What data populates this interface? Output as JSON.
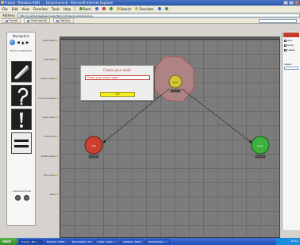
{
  "window": {
    "title": "Fronsk - Rotobna 0691 ... 1fcommerenti - Microsoft Internet Explorer",
    "buttons": [
      "_",
      "□",
      "x"
    ]
  },
  "menubar": {
    "items": [
      "File",
      "Edit",
      "View",
      "Favorites",
      "Tools",
      "Help"
    ],
    "toolbar": [
      "Back",
      "Search",
      "Favorites"
    ]
  },
  "address": {
    "label": "Address",
    "value": "http://localhost/webapp/router/fsm/commercial.php?lang=en"
  },
  "tabs": [
    {
      "label": "Fronsk"
    },
    {
      "label": "Commercial"
    },
    {
      "label": "Options"
    }
  ],
  "left_panel": {
    "title": "Navigation",
    "sub_label": "Protocol FSM Tools",
    "advanced_label": "Advanced tools"
  },
  "edge_labels": [
    "Start state",
    "Add state",
    "Select mode",
    "Connect states",
    "Label state",
    "Comment",
    "Delete state",
    "Fire event",
    "Save"
  ],
  "dialog": {
    "title": "Create your state",
    "input_value": "Enter your state name",
    "button_label": "OK"
  },
  "nodes": [
    {
      "name": "idle",
      "color": "#c9402f"
    },
    {
      "name": "wait",
      "color": "#d4c43a"
    },
    {
      "name": "done",
      "color": "#3db03d"
    }
  ],
  "right_panel": {
    "options": [
      "Grid",
      "Snap",
      "Labels"
    ],
    "spec_label": "Speed"
  },
  "taskbar": {
    "start_label": "start",
    "tasks": [
      "Fronsk - Micr...",
      "Protocol - FSM...",
      "Document1 - M...",
      "Inbox - Outl...",
      "Untitled - Paint",
      "Commercial..."
    ],
    "clock": "10:42"
  }
}
